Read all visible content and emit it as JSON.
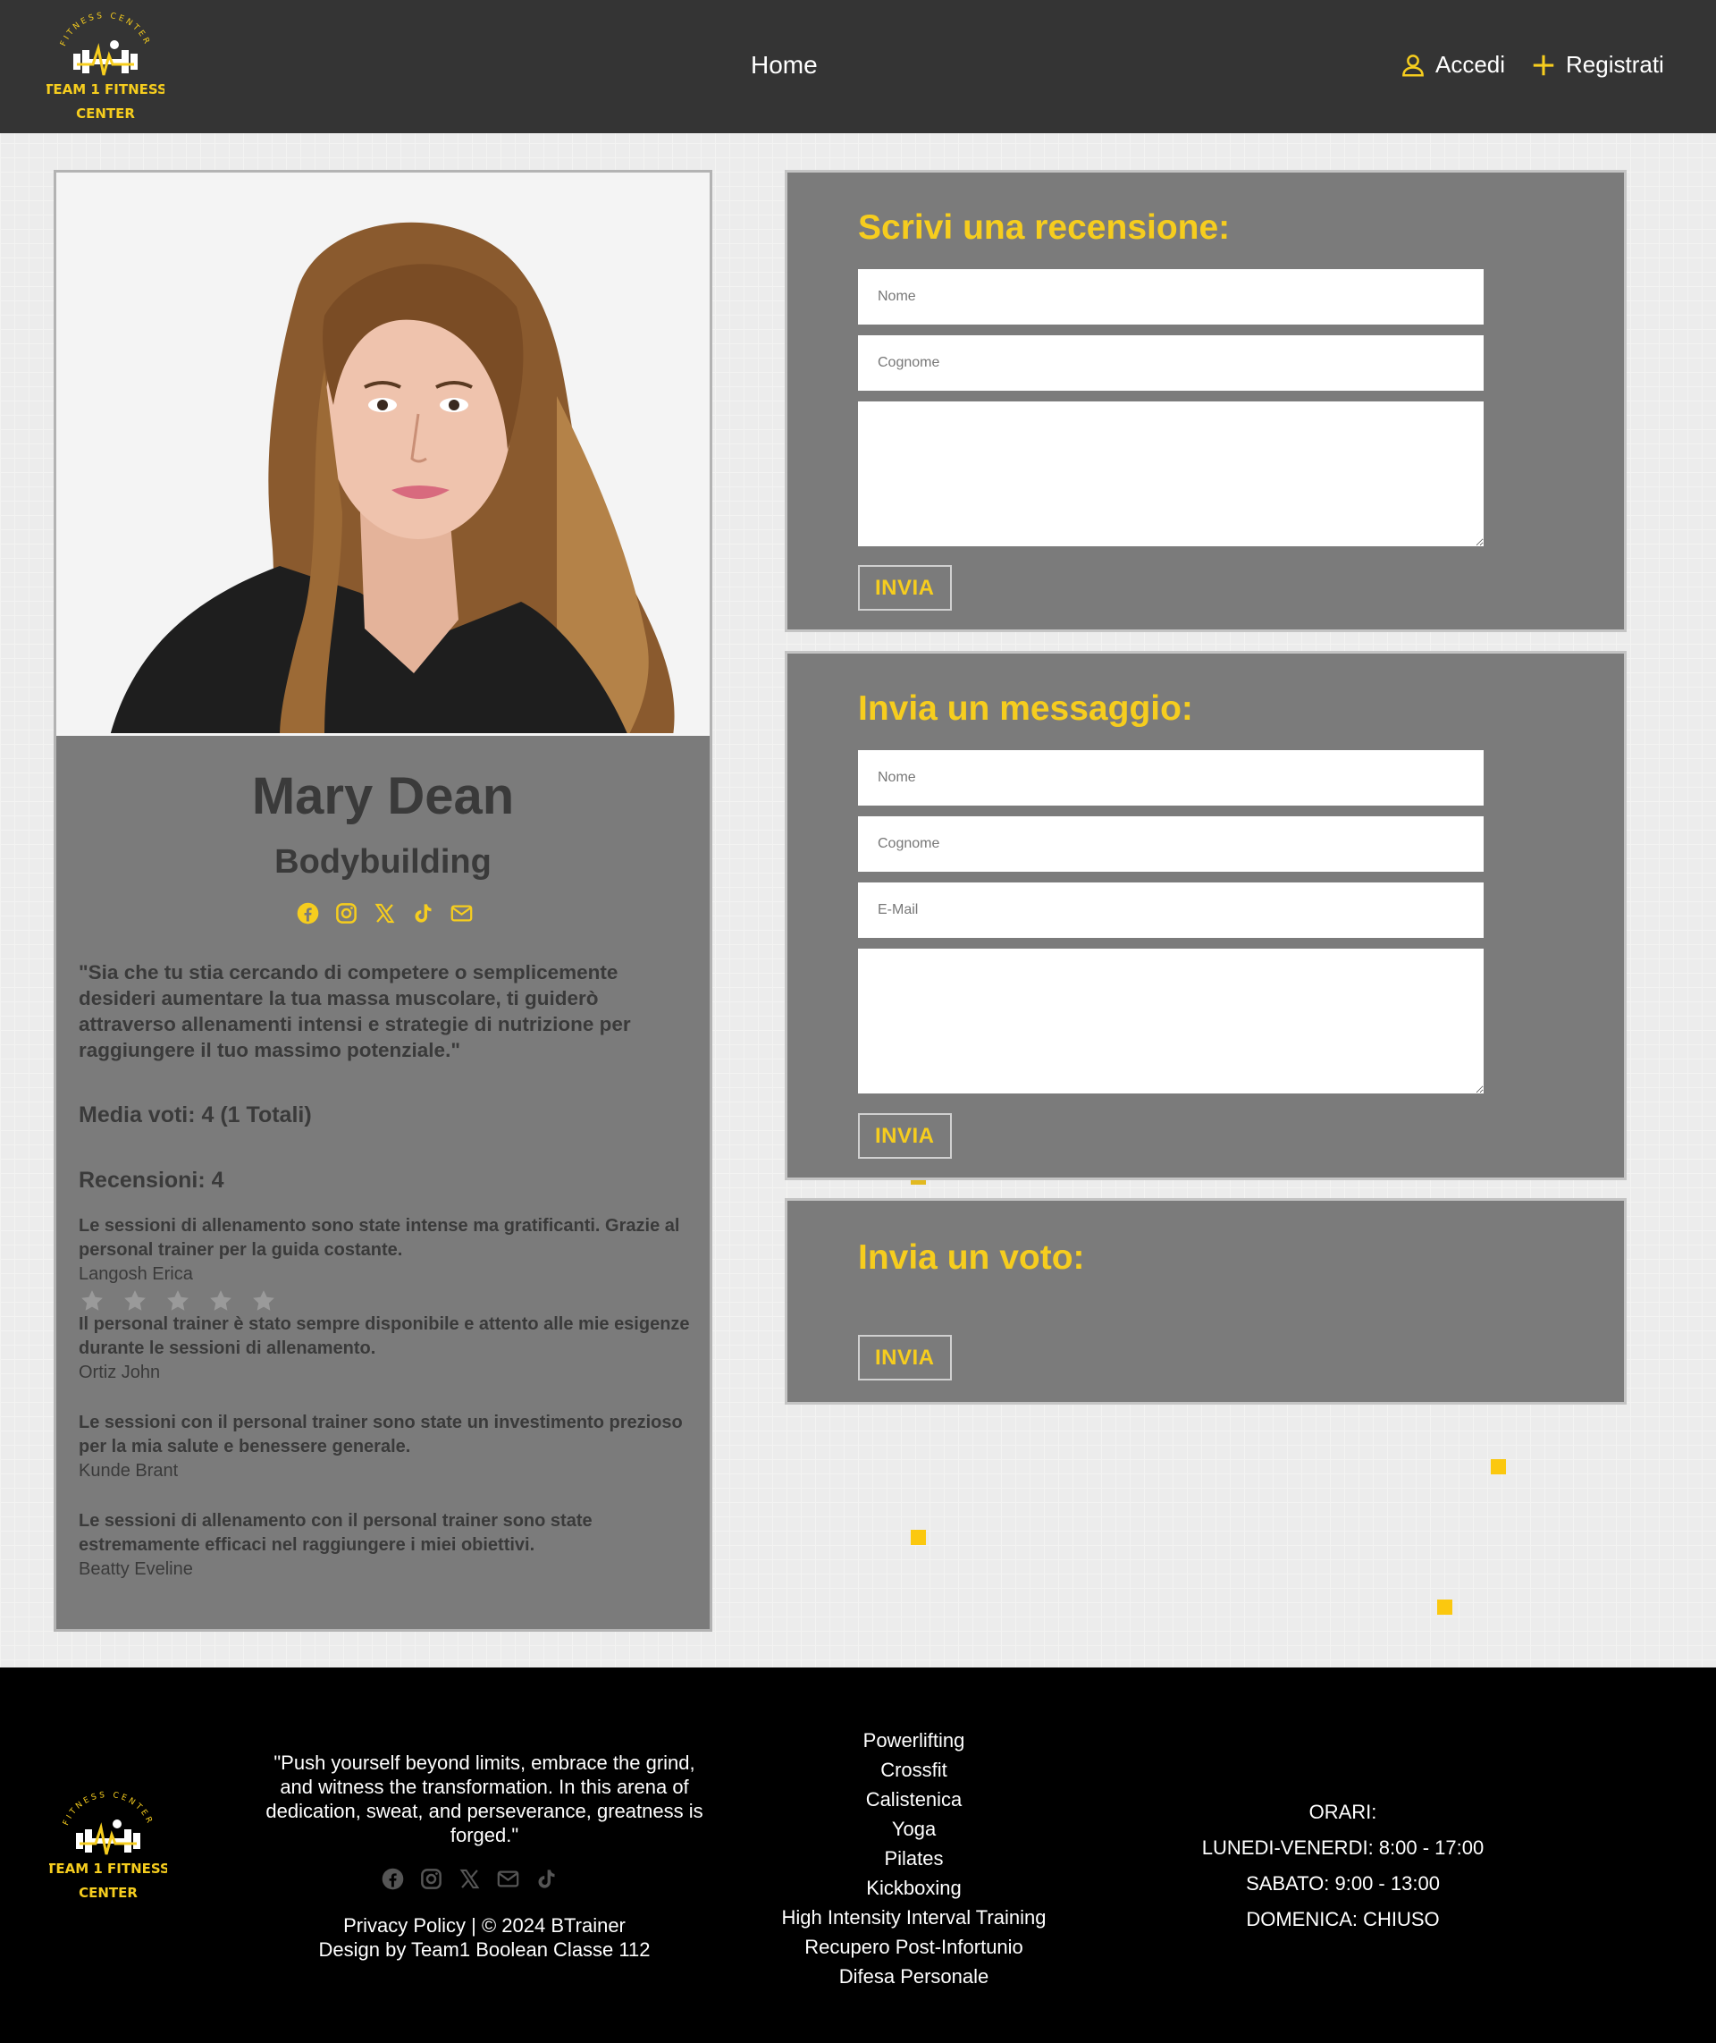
{
  "brand": {
    "logo_arc": "FITNESS CENTER",
    "logo_line1": "TEAM 1 FITNESS",
    "logo_line2": "CENTER"
  },
  "nav": {
    "home": "Home",
    "login": "Accedi",
    "register": "Registrati"
  },
  "trainer": {
    "name": "Mary Dean",
    "specialty": "Bodybuilding",
    "quote": "\"Sia che tu stia cercando di competere o semplicemente desideri aumentare la tua massa muscolare, ti guiderò attraverso allenamenti intensi e strategie di nutrizione per raggiungere il tuo massimo potenziale.\"",
    "rating_avg": "Media voti: 4 (1 Totali)",
    "reviews_title": "Recensioni: 4",
    "social_icons": [
      "facebook-icon",
      "instagram-icon",
      "x-icon",
      "tiktok-icon",
      "envelope-icon"
    ],
    "reviews": [
      {
        "text": "Le sessioni di allenamento sono state intense ma gratificanti. Grazie al personal trainer per la guida costante.",
        "author": "Langosh Erica"
      },
      {
        "text": "Il personal trainer è stato sempre disponibile e attento alle mie esigenze durante le sessioni di allenamento.",
        "author": "Ortiz John"
      },
      {
        "text": "Le sessioni con il personal trainer sono state un investimento prezioso per la mia salute e benessere generale.",
        "author": "Kunde Brant"
      },
      {
        "text": "Le sessioni di allenamento con il personal trainer sono state estremamente efficaci nel raggiungere i miei obiettivi.",
        "author": "Beatty Eveline"
      }
    ]
  },
  "review_form": {
    "title": "Scrivi una recensione:",
    "name_placeholder": "Nome",
    "surname_placeholder": "Cognome",
    "text_placeholder": "",
    "submit": "INVIA"
  },
  "message_form": {
    "title": "Invia un messaggio:",
    "name_placeholder": "Nome",
    "surname_placeholder": "Cognome",
    "email_placeholder": "E-Mail",
    "text_placeholder": "",
    "submit": "INVIA"
  },
  "vote_form": {
    "title": "Invia un voto:",
    "max_stars": 5,
    "selected_stars": 0,
    "submit": "INVIA"
  },
  "footer": {
    "quote": "\"Push yourself beyond limits, embrace the grind, and witness the transformation. In this arena of dedication, sweat, and perseverance, greatness is forged.\"",
    "legal_line1": "Privacy Policy | © 2024 BTrainer",
    "legal_line2": "Design by Team1 Boolean Classe 112",
    "disciplines": [
      "Powerlifting",
      "Crossfit",
      "Calistenica",
      "Yoga",
      "Pilates",
      "Kickboxing",
      "High Intensity Interval Training",
      "Recupero Post-Infortunio",
      "Difesa Personale"
    ],
    "hours_title": "ORARI:",
    "hours_weekdays": "LUNEDI-VENERDI: 8:00 - 17:00",
    "hours_saturday": "SABATO: 9:00 - 13:00",
    "hours_sunday": "DOMENICA: CHIUSO"
  },
  "colors": {
    "accent": "#f6cd1e",
    "header_bg": "#343434",
    "panel_bg": "#7b7b7b",
    "footer_bg": "#000000",
    "text_dark": "#3a3a3a"
  }
}
